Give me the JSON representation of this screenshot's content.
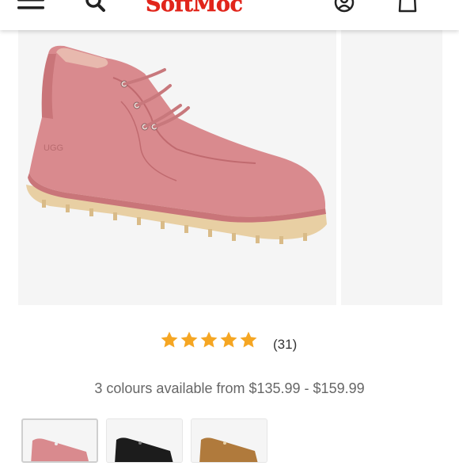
{
  "header": {
    "logo_text": "SoftMoc",
    "brand_color": "#e1251b",
    "icons": [
      "hamburger-menu-icon",
      "search-icon",
      "account-icon",
      "shopping-bag-icon"
    ]
  },
  "gallery": {
    "main_image": "pink-suede-chukka-boot",
    "main_image_logo": "UGG",
    "thumbnails": [
      "pink",
      "black",
      "chestnut"
    ]
  },
  "product": {
    "rating_stars": 5,
    "review_count": "(31)",
    "availability": "3 colours available from $135.99 - $159.99",
    "star_color": "#f5a623"
  },
  "colours": {
    "pink": "#d98a8e",
    "black": "#1c1c1c",
    "chestnut": "#b07a3c"
  }
}
